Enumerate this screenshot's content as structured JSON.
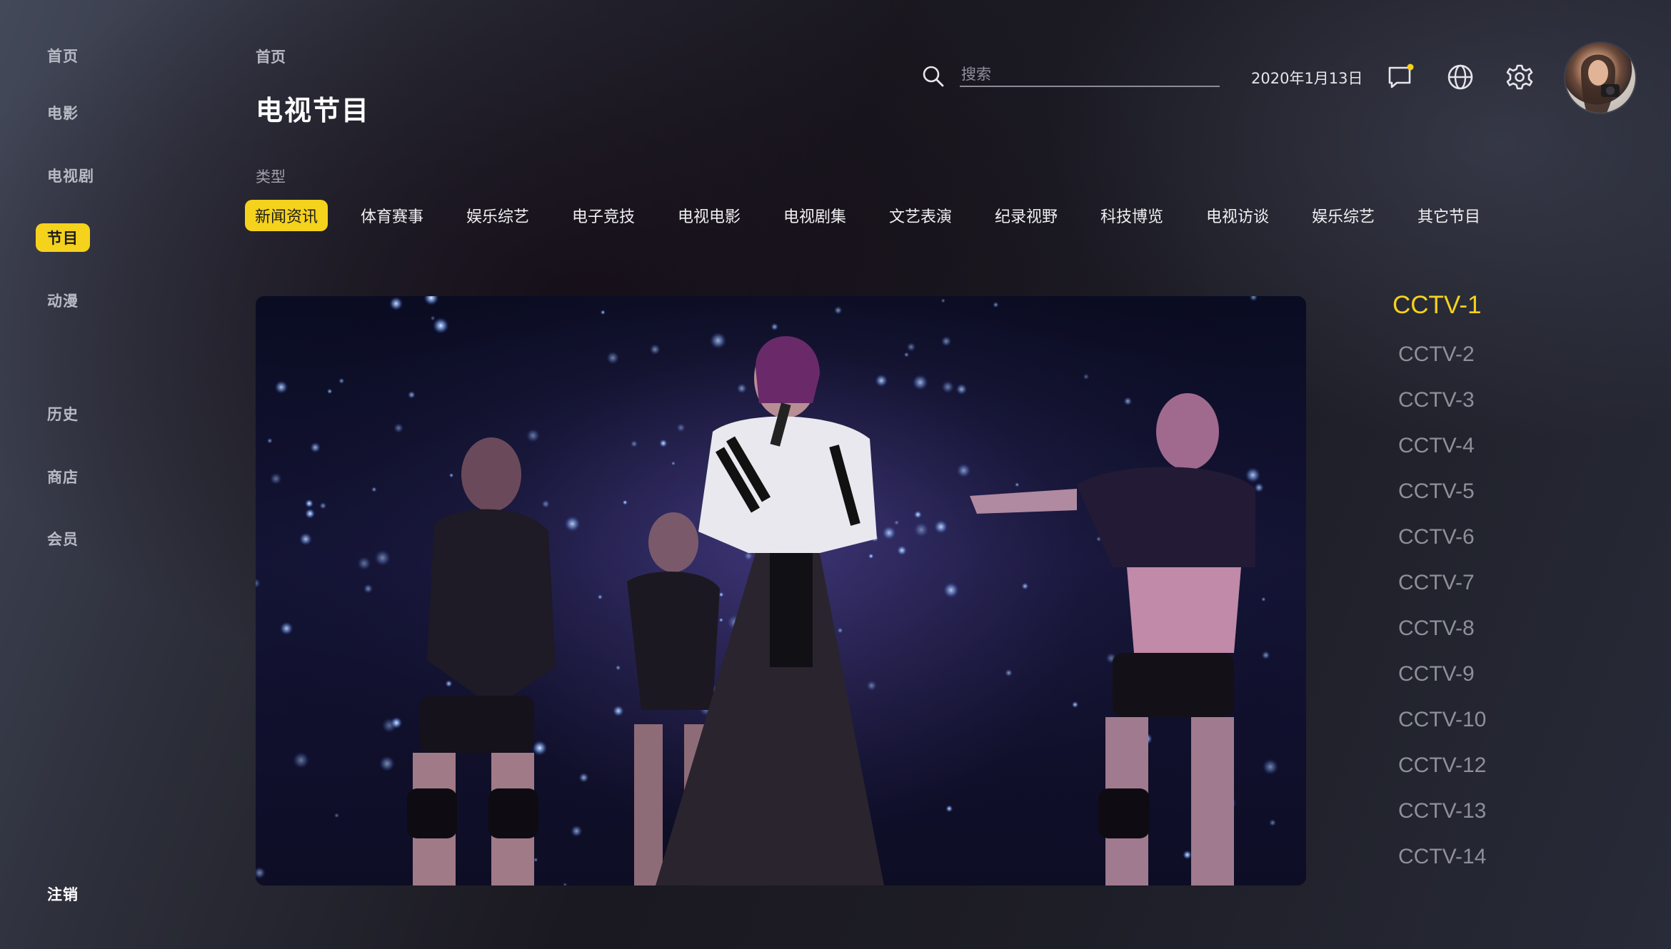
{
  "sidebar": {
    "items": [
      {
        "label": "首页"
      },
      {
        "label": "电影"
      },
      {
        "label": "电视剧"
      },
      {
        "label": "节目",
        "active": true
      },
      {
        "label": "动漫"
      },
      {
        "label": "历史"
      },
      {
        "label": "商店"
      },
      {
        "label": "会员"
      }
    ],
    "logout_label": "注销"
  },
  "header": {
    "breadcrumb": "首页",
    "title": "电视节目",
    "search_placeholder": "搜索",
    "date": "2020年1月13日",
    "icons": [
      "search-icon",
      "message-icon",
      "globe-icon",
      "settings-icon"
    ],
    "has_notification_dot": true
  },
  "category": {
    "label": "类型",
    "tabs": [
      {
        "label": "新闻资讯",
        "active": true
      },
      {
        "label": "体育赛事"
      },
      {
        "label": "娱乐综艺"
      },
      {
        "label": "电子竞技"
      },
      {
        "label": "电视电影"
      },
      {
        "label": "电视剧集"
      },
      {
        "label": "文艺表演"
      },
      {
        "label": "纪录视野"
      },
      {
        "label": "科技博览"
      },
      {
        "label": "电视访谈"
      },
      {
        "label": "娱乐综艺"
      },
      {
        "label": "其它节目"
      }
    ]
  },
  "channels": [
    {
      "label": "CCTV-1",
      "active": true
    },
    {
      "label": "CCTV-2"
    },
    {
      "label": "CCTV-3"
    },
    {
      "label": "CCTV-4"
    },
    {
      "label": "CCTV-5"
    },
    {
      "label": "CCTV-6"
    },
    {
      "label": "CCTV-7"
    },
    {
      "label": "CCTV-8"
    },
    {
      "label": "CCTV-9"
    },
    {
      "label": "CCTV-10"
    },
    {
      "label": "CCTV-12"
    },
    {
      "label": "CCTV-13"
    },
    {
      "label": "CCTV-14"
    }
  ],
  "colors": {
    "accent": "#f5d21c",
    "text_primary": "#ffffff",
    "text_muted": "#8e9099"
  }
}
